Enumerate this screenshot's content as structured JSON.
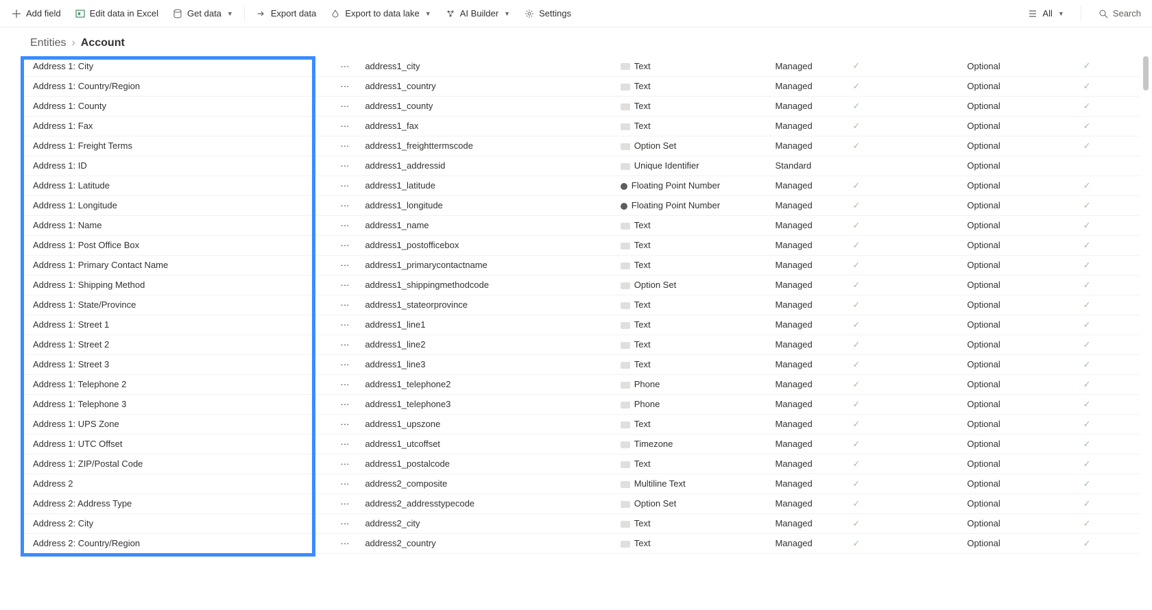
{
  "toolbar": {
    "add_field": "Add field",
    "edit_excel": "Edit data in Excel",
    "get_data": "Get data",
    "export_data": "Export data",
    "export_lake": "Export to data lake",
    "ai_builder": "AI Builder",
    "settings": "Settings",
    "view_all": "All",
    "search": "Search"
  },
  "breadcrumb": {
    "root": "Entities",
    "current": "Account"
  },
  "rows": [
    {
      "display": "Address 1: City",
      "name": "address1_city",
      "type": "Text",
      "icon": "text",
      "managed": "Managed",
      "c1": true,
      "required": "Optional",
      "c2": true
    },
    {
      "display": "Address 1: Country/Region",
      "name": "address1_country",
      "type": "Text",
      "icon": "text",
      "managed": "Managed",
      "c1": true,
      "required": "Optional",
      "c2": true
    },
    {
      "display": "Address 1: County",
      "name": "address1_county",
      "type": "Text",
      "icon": "text",
      "managed": "Managed",
      "c1": true,
      "required": "Optional",
      "c2": true
    },
    {
      "display": "Address 1: Fax",
      "name": "address1_fax",
      "type": "Text",
      "icon": "text",
      "managed": "Managed",
      "c1": true,
      "required": "Optional",
      "c2": true
    },
    {
      "display": "Address 1: Freight Terms",
      "name": "address1_freighttermscode",
      "type": "Option Set",
      "icon": "text",
      "managed": "Managed",
      "c1": true,
      "required": "Optional",
      "c2": true
    },
    {
      "display": "Address 1: ID",
      "name": "address1_addressid",
      "type": "Unique Identifier",
      "icon": "text",
      "managed": "Standard",
      "c1": false,
      "required": "Optional",
      "c2": false
    },
    {
      "display": "Address 1: Latitude",
      "name": "address1_latitude",
      "type": "Floating Point Number",
      "icon": "float",
      "managed": "Managed",
      "c1": true,
      "required": "Optional",
      "c2": true
    },
    {
      "display": "Address 1: Longitude",
      "name": "address1_longitude",
      "type": "Floating Point Number",
      "icon": "float",
      "managed": "Managed",
      "c1": true,
      "required": "Optional",
      "c2": true
    },
    {
      "display": "Address 1: Name",
      "name": "address1_name",
      "type": "Text",
      "icon": "text",
      "managed": "Managed",
      "c1": true,
      "required": "Optional",
      "c2": true
    },
    {
      "display": "Address 1: Post Office Box",
      "name": "address1_postofficebox",
      "type": "Text",
      "icon": "text",
      "managed": "Managed",
      "c1": true,
      "required": "Optional",
      "c2": true
    },
    {
      "display": "Address 1: Primary Contact Name",
      "name": "address1_primarycontactname",
      "type": "Text",
      "icon": "text",
      "managed": "Managed",
      "c1": true,
      "required": "Optional",
      "c2": true
    },
    {
      "display": "Address 1: Shipping Method",
      "name": "address1_shippingmethodcode",
      "type": "Option Set",
      "icon": "text",
      "managed": "Managed",
      "c1": true,
      "required": "Optional",
      "c2": true
    },
    {
      "display": "Address 1: State/Province",
      "name": "address1_stateorprovince",
      "type": "Text",
      "icon": "text",
      "managed": "Managed",
      "c1": true,
      "required": "Optional",
      "c2": true
    },
    {
      "display": "Address 1: Street 1",
      "name": "address1_line1",
      "type": "Text",
      "icon": "text",
      "managed": "Managed",
      "c1": true,
      "required": "Optional",
      "c2": true
    },
    {
      "display": "Address 1: Street 2",
      "name": "address1_line2",
      "type": "Text",
      "icon": "text",
      "managed": "Managed",
      "c1": true,
      "required": "Optional",
      "c2": true
    },
    {
      "display": "Address 1: Street 3",
      "name": "address1_line3",
      "type": "Text",
      "icon": "text",
      "managed": "Managed",
      "c1": true,
      "required": "Optional",
      "c2": true
    },
    {
      "display": "Address 1: Telephone 2",
      "name": "address1_telephone2",
      "type": "Phone",
      "icon": "text",
      "managed": "Managed",
      "c1": true,
      "required": "Optional",
      "c2": true
    },
    {
      "display": "Address 1: Telephone 3",
      "name": "address1_telephone3",
      "type": "Phone",
      "icon": "text",
      "managed": "Managed",
      "c1": true,
      "required": "Optional",
      "c2": true
    },
    {
      "display": "Address 1: UPS Zone",
      "name": "address1_upszone",
      "type": "Text",
      "icon": "text",
      "managed": "Managed",
      "c1": true,
      "required": "Optional",
      "c2": true
    },
    {
      "display": "Address 1: UTC Offset",
      "name": "address1_utcoffset",
      "type": "Timezone",
      "icon": "text",
      "managed": "Managed",
      "c1": true,
      "required": "Optional",
      "c2": true
    },
    {
      "display": "Address 1: ZIP/Postal Code",
      "name": "address1_postalcode",
      "type": "Text",
      "icon": "text",
      "managed": "Managed",
      "c1": true,
      "required": "Optional",
      "c2": true
    },
    {
      "display": "Address 2",
      "name": "address2_composite",
      "type": "Multiline Text",
      "icon": "text",
      "managed": "Managed",
      "c1": true,
      "required": "Optional",
      "c2": true
    },
    {
      "display": "Address 2: Address Type",
      "name": "address2_addresstypecode",
      "type": "Option Set",
      "icon": "text",
      "managed": "Managed",
      "c1": true,
      "required": "Optional",
      "c2": true
    },
    {
      "display": "Address 2: City",
      "name": "address2_city",
      "type": "Text",
      "icon": "text",
      "managed": "Managed",
      "c1": true,
      "required": "Optional",
      "c2": true
    },
    {
      "display": "Address 2: Country/Region",
      "name": "address2_country",
      "type": "Text",
      "icon": "text",
      "managed": "Managed",
      "c1": true,
      "required": "Optional",
      "c2": true
    }
  ]
}
